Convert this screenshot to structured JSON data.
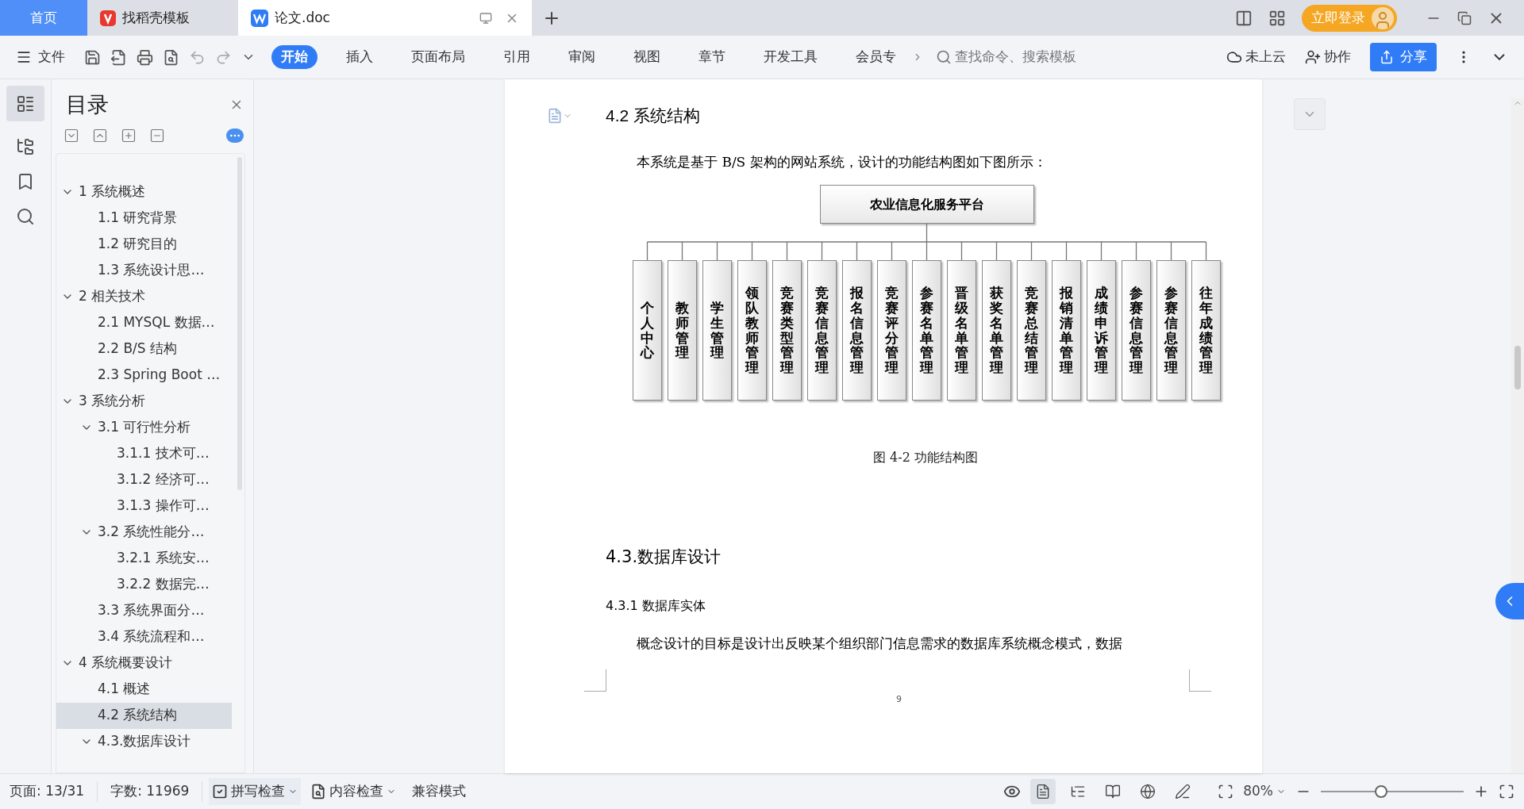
{
  "tabs": [
    {
      "label": "首页",
      "selected": false,
      "kind": "home"
    },
    {
      "label": "找稻壳模板",
      "selected": false,
      "kind": "docer"
    },
    {
      "label": "论文.doc",
      "selected": true,
      "kind": "document"
    }
  ],
  "login_button": "立即登录",
  "toolbar": {
    "file_menu": "文件",
    "ribbon_tabs": [
      {
        "label": "开始",
        "selected": true
      },
      {
        "label": "插入",
        "selected": false
      },
      {
        "label": "页面布局",
        "selected": false
      },
      {
        "label": "引用",
        "selected": false
      },
      {
        "label": "审阅",
        "selected": false
      },
      {
        "label": "视图",
        "selected": false
      },
      {
        "label": "章节",
        "selected": false
      },
      {
        "label": "开发工具",
        "selected": false
      },
      {
        "label": "会员专",
        "selected": false
      }
    ],
    "search": {
      "placeholder": "查找命令、搜索模板"
    },
    "cloud": "未上云",
    "collaborate": "协作",
    "share": "分享"
  },
  "toc": {
    "title": "目录",
    "items": [
      {
        "label": "1 系统概述",
        "selected": false,
        "expanded": true,
        "children": [
          {
            "label": "1.1  研究背景",
            "selected": false
          },
          {
            "label": "1.2 研究目的",
            "selected": false
          },
          {
            "label": "1.3 系统设计思…",
            "selected": false
          }
        ]
      },
      {
        "label": "2 相关技术",
        "selected": false,
        "expanded": true,
        "children": [
          {
            "label": "2.1 MYSQL 数据…",
            "selected": false
          },
          {
            "label": "2.2 B/S 结构",
            "selected": false
          },
          {
            "label": "2.3 Spring Boot …",
            "selected": false
          }
        ]
      },
      {
        "label": "3 系统分析",
        "selected": false,
        "expanded": true,
        "children": [
          {
            "label": "3.1 可行性分析",
            "selected": false,
            "expanded": true,
            "children": [
              {
                "label": "3.1.1 技术可…",
                "selected": false
              },
              {
                "label": "3.1.2 经济可…",
                "selected": false
              },
              {
                "label": "3.1.3 操作可…",
                "selected": false
              }
            ]
          },
          {
            "label": "3.2 系统性能分…",
            "selected": false,
            "expanded": true,
            "children": [
              {
                "label": "3.2.1  系统安…",
                "selected": false
              },
              {
                "label": "3.2.2  数据完…",
                "selected": false
              }
            ]
          },
          {
            "label": "3.3 系统界面分…",
            "selected": false
          },
          {
            "label": "3.4 系统流程和…",
            "selected": false
          }
        ]
      },
      {
        "label": "4 系统概要设计",
        "selected": false,
        "expanded": true,
        "children": [
          {
            "label": "4.1 概述",
            "selected": false
          },
          {
            "label": "4.2 系统结构",
            "selected": true
          },
          {
            "label": "4.3.数据库设计",
            "selected": false,
            "expanded": true
          }
        ]
      }
    ]
  },
  "document": {
    "heading": "4.2 系统结构",
    "intro": "本系统是基于 B/S 架构的网站系统，设计的功能结构图如下图所示：",
    "diagram": {
      "root": "农业信息化服务平台",
      "children": [
        "个人中心",
        "教师管理",
        "学生管理",
        "领队教师管理",
        "竞赛类型管理",
        "竞赛信息管理",
        "报名信息管理",
        "竞赛评分管理",
        "参赛名单管理",
        "晋级名单管理",
        "获奖名单管理",
        "竞赛总结管理",
        "报销清单管理",
        "成绩申诉管理",
        "参赛信息管理",
        "参赛信息管理",
        "往年成绩管理"
      ]
    },
    "caption": "图 4-2 功能结构图",
    "section": "4.3.数据库设计",
    "subsection": "4.3.1 数据库实体",
    "paragraph": "概念设计的目标是设计出反映某个组织部门信息需求的数据库系统概念模式，数据",
    "page_number": "9"
  },
  "status_bar": {
    "page": "页面: 13/31",
    "words": "字数: 11969",
    "spell_check": "拼写检查",
    "content_check": "内容检查",
    "compatibility": "兼容模式",
    "view_modes": [
      {
        "kind": "page",
        "selected": true
      },
      {
        "kind": "outline",
        "selected": false
      },
      {
        "kind": "reading",
        "selected": false
      },
      {
        "kind": "web",
        "selected": false
      },
      {
        "kind": "pen",
        "selected": false
      }
    ],
    "zoom": "80%",
    "zoom_slider": {
      "level": 0.42
    }
  }
}
